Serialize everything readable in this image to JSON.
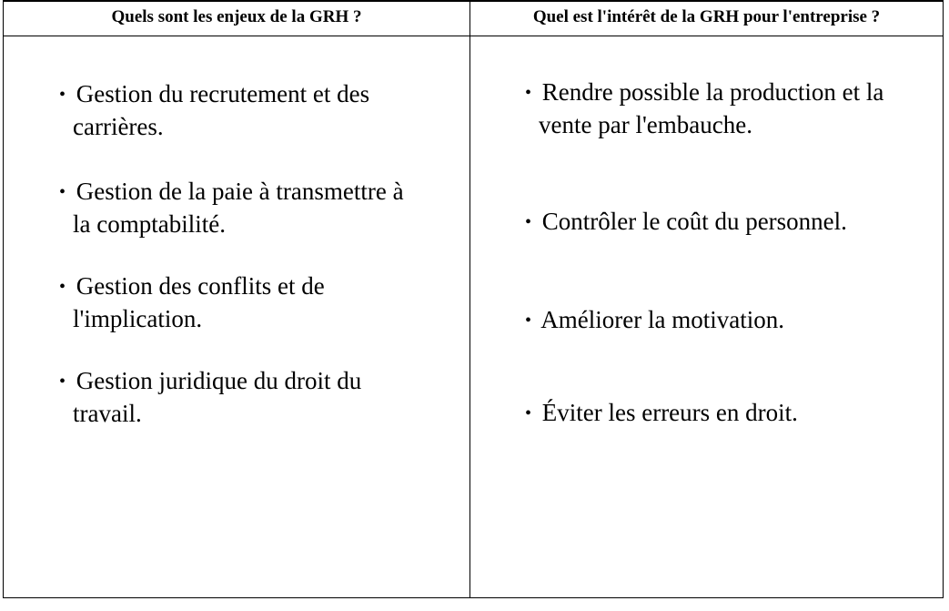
{
  "table": {
    "columns": [
      {
        "header": "Quels sont les enjeux de la GRH ?",
        "items": [
          {
            "line1": "Gestion du recrutement et des",
            "line2": "carrières."
          },
          {
            "line1": "Gestion de la paie à transmettre à",
            "line2": "la comptabilité."
          },
          {
            "line1": "Gestion des conflits et de",
            "line2": "l'implication."
          },
          {
            "line1": "Gestion juridique du droit du",
            "line2": "travail."
          }
        ]
      },
      {
        "header": "Quel est l'intérêt de la GRH pour l'entreprise ?",
        "items": [
          {
            "line1": "Rendre possible la production et la",
            "line2": "vente par l'embauche."
          },
          {
            "line1": "Contrôler le coût du personnel.",
            "line2": ""
          },
          {
            "line1": "Améliorer la motivation.",
            "line2": ""
          },
          {
            "line1": "Éviter les erreurs en droit.",
            "line2": ""
          }
        ]
      }
    ],
    "bullet": "•"
  }
}
